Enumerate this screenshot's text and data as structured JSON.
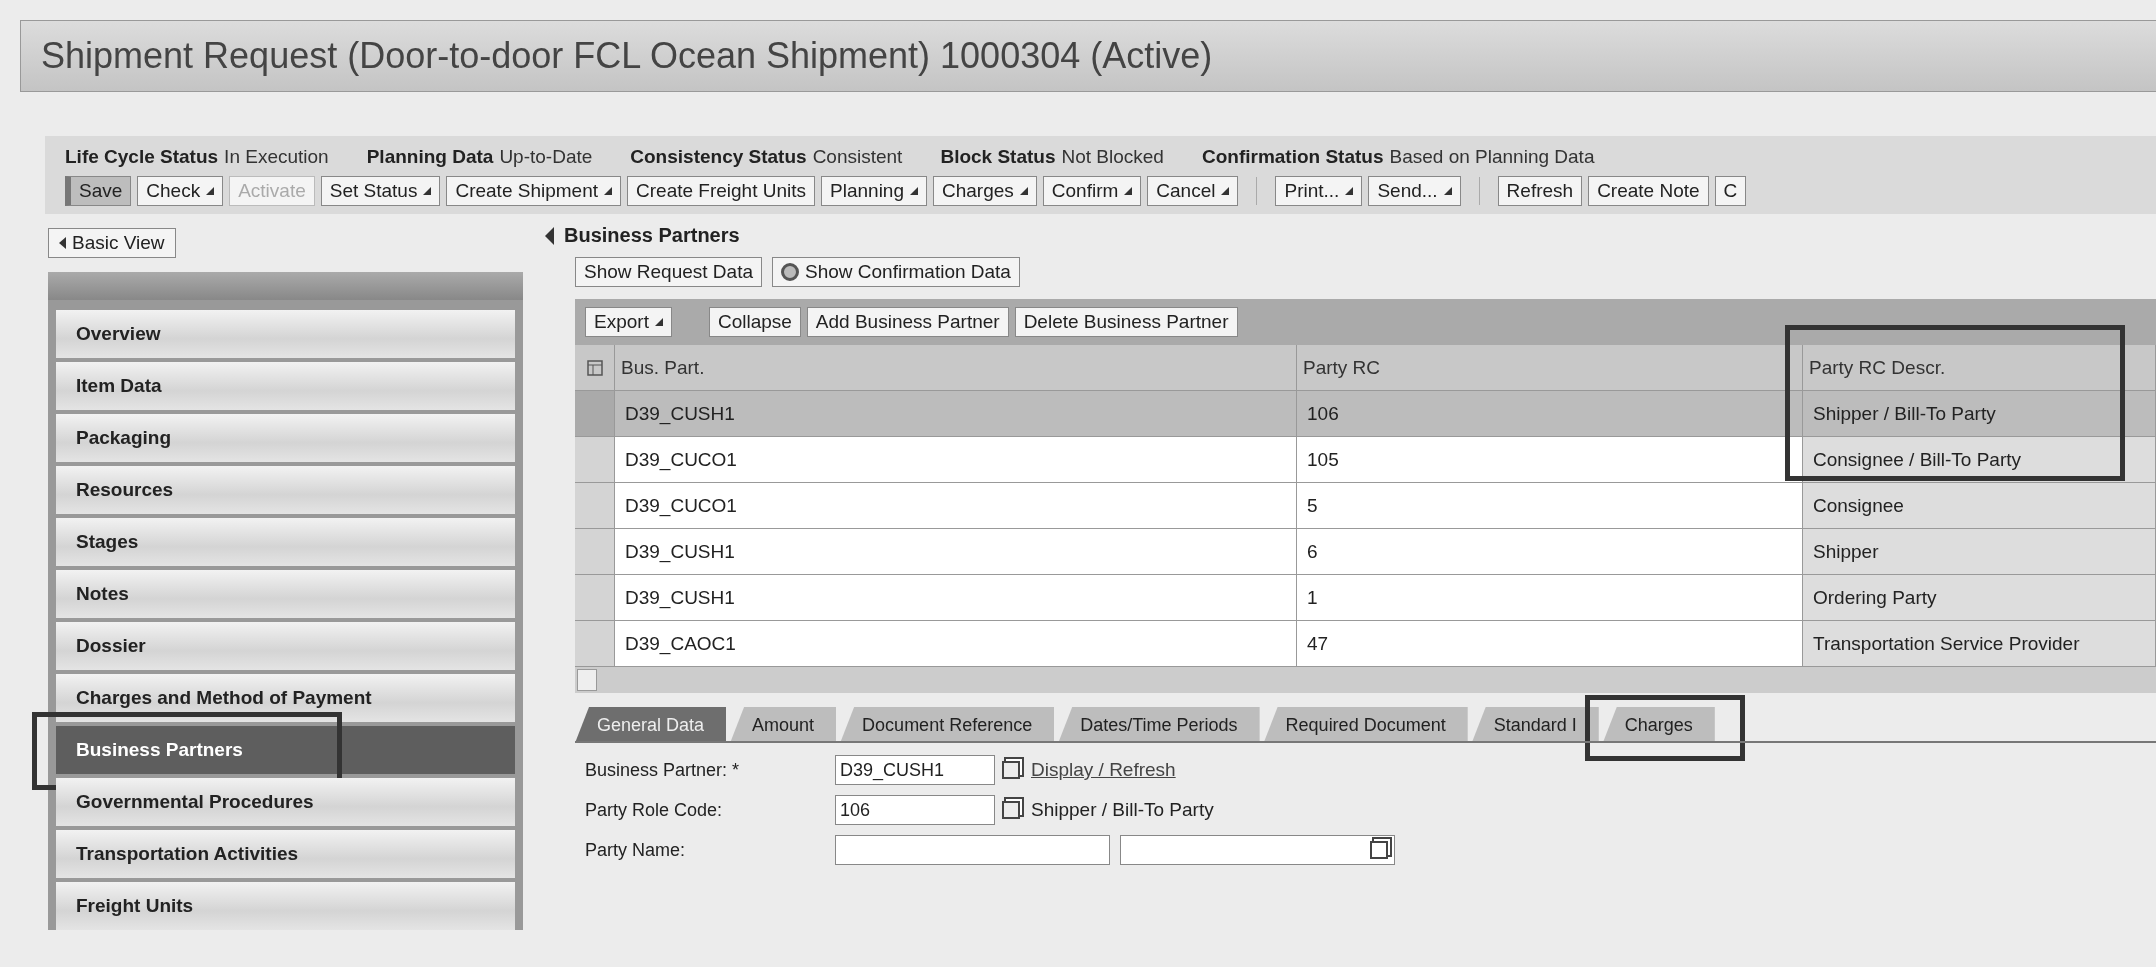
{
  "window": {
    "title": "Shipment Request (Door-to-door FCL Ocean Shipment) 1000304 (Active)"
  },
  "status_items": [
    {
      "label": "Life Cycle Status",
      "value": "In Execution"
    },
    {
      "label": "Planning Data",
      "value": "Up-to-Date"
    },
    {
      "label": "Consistency Status",
      "value": "Consistent"
    },
    {
      "label": "Block Status",
      "value": "Not Blocked"
    },
    {
      "label": "Confirmation Status",
      "value": "Based on Planning Data"
    }
  ],
  "toolbar": [
    {
      "buttons": [
        {
          "label": "Save",
          "dropdown": false,
          "disabled": false,
          "emphasized": true
        },
        {
          "label": "Check",
          "dropdown": true,
          "disabled": false,
          "emphasized": false
        },
        {
          "label": "Activate",
          "dropdown": false,
          "disabled": true,
          "emphasized": false
        },
        {
          "label": "Set Status",
          "dropdown": true,
          "disabled": false,
          "emphasized": false
        },
        {
          "label": "Create Shipment",
          "dropdown": true,
          "disabled": false,
          "emphasized": false
        },
        {
          "label": "Create Freight Units",
          "dropdown": false,
          "disabled": false,
          "emphasized": false
        },
        {
          "label": "Planning",
          "dropdown": true,
          "disabled": false,
          "emphasized": false
        },
        {
          "label": "Charges",
          "dropdown": true,
          "disabled": false,
          "emphasized": false
        },
        {
          "label": "Confirm",
          "dropdown": true,
          "disabled": false,
          "emphasized": false
        },
        {
          "label": "Cancel",
          "dropdown": true,
          "disabled": false,
          "emphasized": false
        }
      ]
    },
    {
      "buttons": [
        {
          "label": "Print...",
          "dropdown": true,
          "disabled": false,
          "emphasized": false
        },
        {
          "label": "Send...",
          "dropdown": true,
          "disabled": false,
          "emphasized": false
        }
      ]
    },
    {
      "buttons": [
        {
          "label": "Refresh",
          "dropdown": false,
          "disabled": false,
          "emphasized": false
        },
        {
          "label": "Create Note",
          "dropdown": false,
          "disabled": false,
          "emphasized": false
        },
        {
          "label": "C",
          "dropdown": false,
          "disabled": false,
          "emphasized": false
        }
      ]
    }
  ],
  "basic_view_button": "Basic View",
  "sidebar": {
    "items": [
      {
        "label": "Overview",
        "selected": false,
        "highlighted": false
      },
      {
        "label": "Item Data",
        "selected": false,
        "highlighted": false
      },
      {
        "label": "Packaging",
        "selected": false,
        "highlighted": false
      },
      {
        "label": "Resources",
        "selected": false,
        "highlighted": false
      },
      {
        "label": "Stages",
        "selected": false,
        "highlighted": false
      },
      {
        "label": "Notes",
        "selected": false,
        "highlighted": false
      },
      {
        "label": "Dossier",
        "selected": false,
        "highlighted": false
      },
      {
        "label": "Charges and Method of Payment",
        "selected": false,
        "highlighted": false
      },
      {
        "label": "Business Partners",
        "selected": true,
        "highlighted": true
      },
      {
        "label": "Governmental Procedures",
        "selected": false,
        "highlighted": false
      },
      {
        "label": "Transportation Activities",
        "selected": false,
        "highlighted": false
      },
      {
        "label": "Freight Units",
        "selected": false,
        "highlighted": false
      }
    ]
  },
  "section": {
    "title": "Business Partners",
    "view_buttons": [
      "Show Request Data",
      "Show Confirmation Data"
    ]
  },
  "table": {
    "toolbar": [
      {
        "label": "Export",
        "dropdown": true
      },
      {
        "label": "Collapse",
        "dropdown": false
      },
      {
        "label": "Add Business Partner",
        "dropdown": false
      },
      {
        "label": "Delete Business Partner",
        "dropdown": false
      }
    ],
    "columns": [
      {
        "label": "Bus. Part.",
        "highlighted": false
      },
      {
        "label": "Party RC",
        "highlighted": false
      },
      {
        "label": "Party RC Descr.",
        "highlighted": true
      }
    ],
    "rows": [
      {
        "selected": true,
        "cells": [
          "D39_CUSH1",
          "106",
          "Shipper / Bill-To Party"
        ]
      },
      {
        "selected": false,
        "cells": [
          "D39_CUCO1",
          "105",
          "Consignee / Bill-To Party"
        ]
      },
      {
        "selected": false,
        "cells": [
          "D39_CUCO1",
          "5",
          "Consignee"
        ]
      },
      {
        "selected": false,
        "cells": [
          "D39_CUSH1",
          "6",
          "Shipper"
        ]
      },
      {
        "selected": false,
        "cells": [
          "D39_CUSH1",
          "1",
          "Ordering Party"
        ]
      },
      {
        "selected": false,
        "cells": [
          "D39_CAOC1",
          "47",
          "Transportation Service Provider"
        ]
      }
    ]
  },
  "tabs": [
    {
      "label": "General Data",
      "selected": true,
      "highlighted": false
    },
    {
      "label": "Amount",
      "selected": false,
      "highlighted": false
    },
    {
      "label": "Document Reference",
      "selected": false,
      "highlighted": false
    },
    {
      "label": "Dates/Time Periods",
      "selected": false,
      "highlighted": false
    },
    {
      "label": "Required Document",
      "selected": false,
      "highlighted": false
    },
    {
      "label": "Standard I",
      "selected": false,
      "highlighted": false
    },
    {
      "label": "Charges",
      "selected": false,
      "highlighted": true
    }
  ],
  "form": [
    {
      "kind": "link",
      "label": "Business Partner: *",
      "value": "D39_CUSH1",
      "link": "Display / Refresh"
    },
    {
      "kind": "description",
      "label": "Party Role Code:",
      "value": "106",
      "description": "Shipper / Bill-To Party"
    },
    {
      "kind": "double",
      "label": "Party Name:"
    }
  ]
}
